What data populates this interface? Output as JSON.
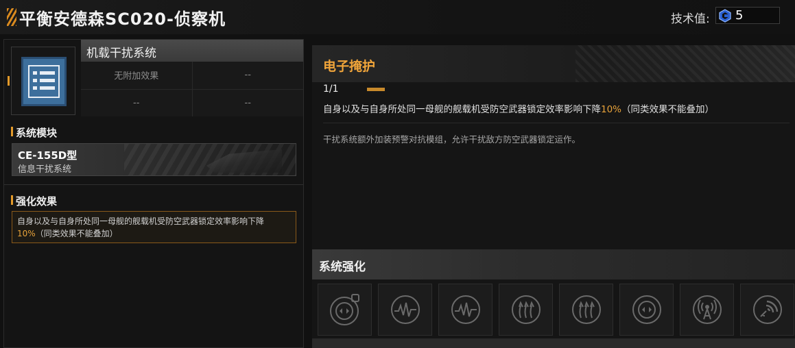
{
  "header": {
    "title": "平衡安德森SC020-侦察机",
    "tech_label": "技术值:",
    "tech_value": "5",
    "tech_icon": "tech-point-icon"
  },
  "module": {
    "name": "机载干扰系统",
    "icon": "module-list-icon",
    "effects": [
      "无附加效果",
      "--",
      "--",
      "--"
    ]
  },
  "system_module": {
    "label": "系统模块",
    "model": "CE-155D型",
    "type": "信息干扰系统"
  },
  "enhancement": {
    "label": "强化效果",
    "text_pre": "自身以及与自身所处同一母舰的舰载机受防空武器锁定效率影响下降",
    "value": "10%",
    "text_post": "（同类效果不能叠加）"
  },
  "skill": {
    "title": "电子掩护",
    "level": "1/1",
    "level_fraction": 1.0,
    "desc_pre": "自身以及与自身所处同一母舰的舰载机受防空武器锁定效率影响下降",
    "desc_value": "10%",
    "desc_post": "（同类效果不能叠加）",
    "flavor": "干扰系统额外加装预警对抗模组，允许干扰敌方防空武器锁定运作。"
  },
  "system_upgrade": {
    "label": "系统强化",
    "slots": [
      {
        "icon": "target-radar-lock-icon"
      },
      {
        "icon": "signal-wave-icon"
      },
      {
        "icon": "signal-wave-icon"
      },
      {
        "icon": "triple-arrow-up-icon"
      },
      {
        "icon": "triple-arrow-up-icon"
      },
      {
        "icon": "target-radar-icon"
      },
      {
        "icon": "broadcast-tower-icon"
      },
      {
        "icon": "radar-sweep-icon"
      }
    ]
  },
  "colors": {
    "accent": "#e39a2a",
    "skill_title": "#f1a53a",
    "module_icon_bg": "#3d6f9c"
  }
}
